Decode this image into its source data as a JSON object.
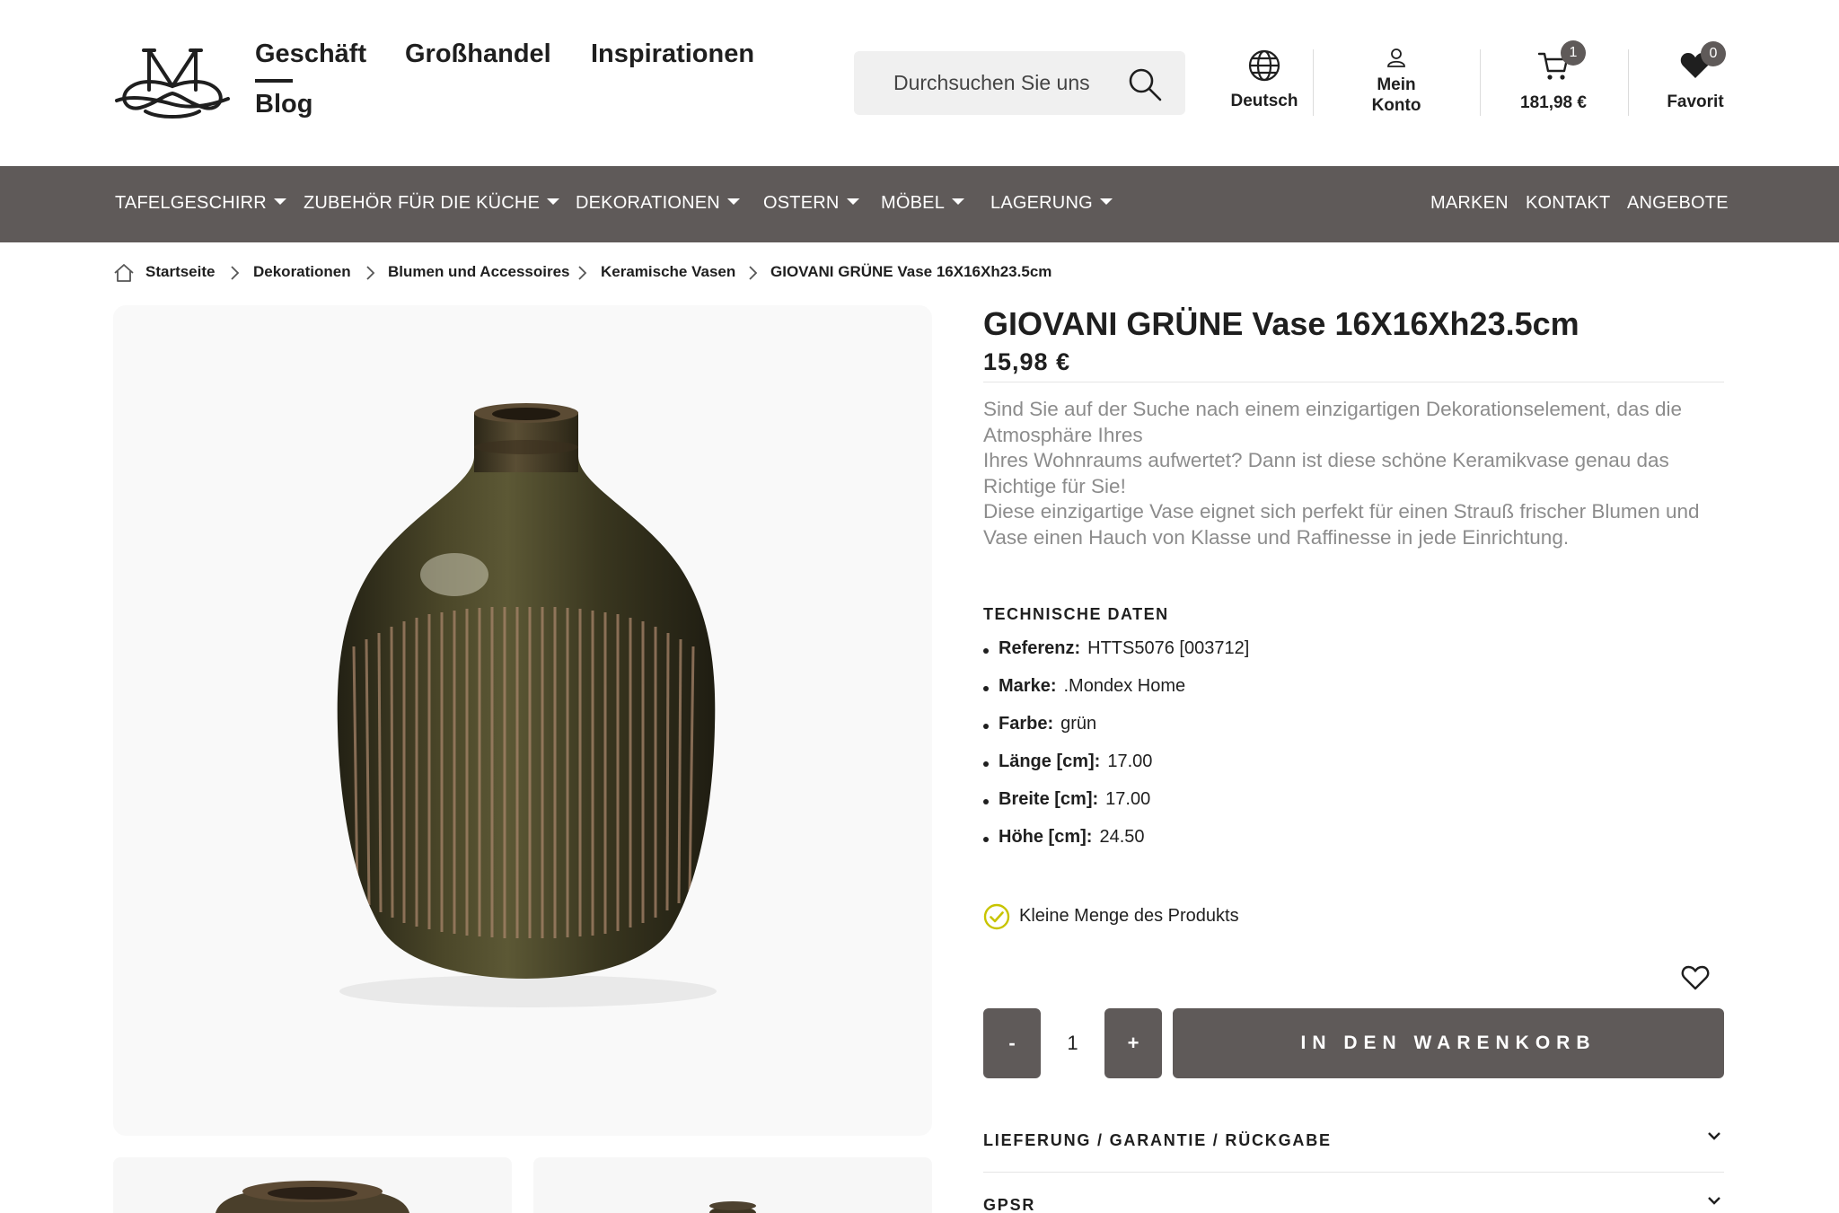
{
  "nav": {
    "items": [
      {
        "label": "Geschäft",
        "active": true
      },
      {
        "label": "Großhandel"
      },
      {
        "label": "Inspirationen"
      },
      {
        "label": "Blog"
      }
    ]
  },
  "search": {
    "placeholder": "Durchsuchen Sie uns"
  },
  "header": {
    "language_label": "Deutsch",
    "account_line1": "Mein",
    "account_line2": "Konto",
    "cart_total": "181,98 €",
    "cart_count": "1",
    "favorites_label": "Favorit",
    "favorites_count": "0"
  },
  "categories": [
    {
      "label": "TAFELGESCHIRR",
      "dropdown": true
    },
    {
      "label": "ZUBEHÖR FÜR DIE KÜCHE",
      "dropdown": true
    },
    {
      "label": "DEKORATIONEN",
      "dropdown": true
    },
    {
      "label": "OSTERN",
      "dropdown": true
    },
    {
      "label": "MÖBEL",
      "dropdown": true
    },
    {
      "label": "LAGERUNG",
      "dropdown": true
    }
  ],
  "secondary_links": [
    "MARKEN",
    "KONTAKT",
    "ANGEBOTE"
  ],
  "breadcrumb": [
    "Startseite",
    "Dekorationen",
    "Blumen und Accessoires",
    "Keramische Vasen",
    "GIOVANI GRÜNE Vase 16X16Xh23.5cm"
  ],
  "product": {
    "title": "GIOVANI GRÜNE Vase 16X16Xh23.5cm",
    "price": "15,98 €",
    "description": [
      "Sind Sie auf der Suche nach einem einzigartigen Dekorationselement, das die Atmosphäre Ihres",
      "Ihres Wohnraums aufwertet? Dann ist diese schöne Keramikvase genau das Richtige für Sie!",
      "Diese einzigartige Vase eignet sich perfekt für einen Strauß frischer Blumen und",
      "Vase einen Hauch von Klasse und Raffinesse in jede Einrichtung."
    ],
    "specs_title": "TECHNISCHE DATEN",
    "specs": [
      {
        "label": "Referenz:",
        "value": "HTTS5076 [003712]"
      },
      {
        "label": "Marke:",
        "value": ".Mondex Home"
      },
      {
        "label": "Farbe:",
        "value": "grün"
      },
      {
        "label": "Länge [cm]:",
        "value": "17.00"
      },
      {
        "label": "Breite [cm]:",
        "value": "17.00"
      },
      {
        "label": "Höhe [cm]:",
        "value": "24.50"
      }
    ],
    "stock_text": "Kleine Menge des Produkts",
    "quantity": "1",
    "minus_label": "-",
    "plus_label": "+",
    "add_to_cart_label": "IN DEN WARENKORB",
    "accordions": [
      "LIEFERUNG / GARANTIE / RÜCKGABE",
      "GPSR"
    ]
  },
  "colors": {
    "bar": "#5f5a59",
    "stock_check": "#c8c400",
    "vase_glaze": "#3d3a22"
  }
}
